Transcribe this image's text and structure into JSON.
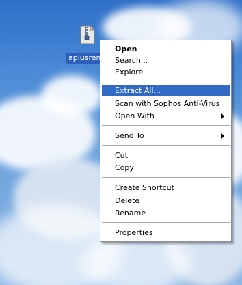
{
  "desktop": {
    "icon": {
      "name": "zip-folder-icon",
      "label": "aplusrem"
    }
  },
  "context_menu": {
    "group1": [
      "Open",
      "Search...",
      "Explore"
    ],
    "group2": [
      "Extract All...",
      "Scan with Sophos Anti-Virus",
      "Open With"
    ],
    "group3": [
      "Send To"
    ],
    "group4": [
      "Cut",
      "Copy"
    ],
    "group5": [
      "Create Shortcut",
      "Delete",
      "Rename"
    ],
    "group6": [
      "Properties"
    ],
    "default_item": "Open",
    "highlighted_item": "Extract All..."
  },
  "colors": {
    "highlight": "#316ac5",
    "desktop_sky": "#3f7fd0"
  }
}
